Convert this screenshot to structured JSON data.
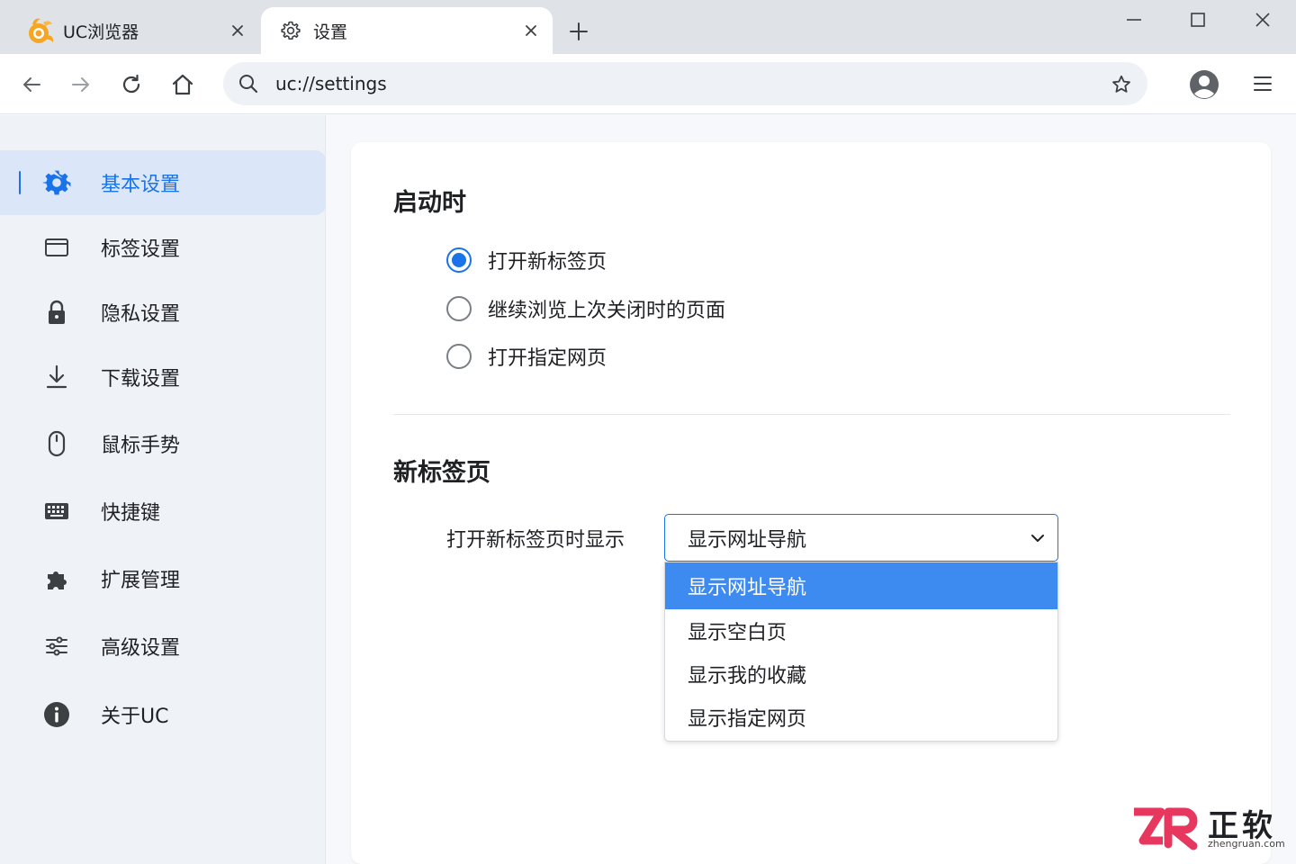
{
  "tabs": [
    {
      "title": "UC浏览器",
      "icon": "uc-logo-icon",
      "active": false
    },
    {
      "title": "设置",
      "icon": "gear-icon",
      "active": true
    }
  ],
  "toolbar": {
    "url": "uc://settings"
  },
  "sidebar": {
    "items": [
      {
        "label": "基本设置",
        "icon": "gear-icon",
        "active": true
      },
      {
        "label": "标签设置",
        "icon": "tab-icon",
        "active": false
      },
      {
        "label": "隐私设置",
        "icon": "lock-icon",
        "active": false
      },
      {
        "label": "下载设置",
        "icon": "download-icon",
        "active": false
      },
      {
        "label": "鼠标手势",
        "icon": "mouse-icon",
        "active": false
      },
      {
        "label": "快捷键",
        "icon": "keyboard-icon",
        "active": false
      },
      {
        "label": "扩展管理",
        "icon": "puzzle-icon",
        "active": false
      },
      {
        "label": "高级设置",
        "icon": "sliders-icon",
        "active": false
      },
      {
        "label": "关于UC",
        "icon": "info-icon",
        "active": false
      }
    ]
  },
  "startup": {
    "title": "启动时",
    "options": [
      {
        "label": "打开新标签页",
        "checked": true
      },
      {
        "label": "继续浏览上次关闭时的页面",
        "checked": false
      },
      {
        "label": "打开指定网页",
        "checked": false
      }
    ]
  },
  "newtab": {
    "title": "新标签页",
    "field_label": "打开新标签页时显示",
    "select_value": "显示网址导航",
    "dropdown_options": [
      {
        "label": "显示网址导航",
        "selected": true
      },
      {
        "label": "显示空白页",
        "selected": false
      },
      {
        "label": "显示我的收藏",
        "selected": false
      },
      {
        "label": "显示指定网页",
        "selected": false
      }
    ]
  },
  "watermark": {
    "name": "正软",
    "domain": "zhengruan.com"
  },
  "colors": {
    "accent": "#1a73e8",
    "dropdown_highlight": "#3d8bf0",
    "sidebar_active_bg": "#dbe7f8"
  }
}
